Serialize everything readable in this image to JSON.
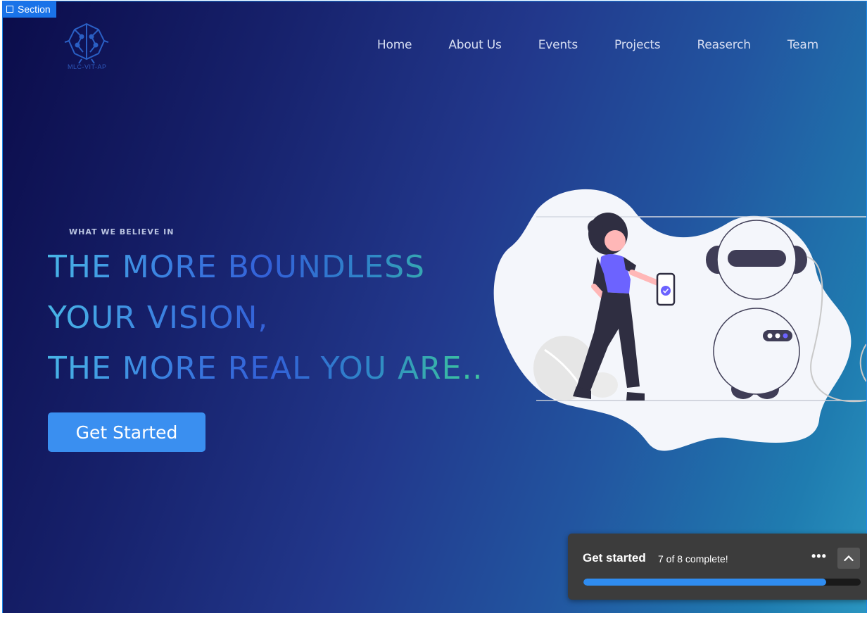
{
  "selection_tag": {
    "label": "Section"
  },
  "brand": {
    "logo_text": "MLC-VIT-AP"
  },
  "nav": {
    "items": [
      {
        "label": "Home"
      },
      {
        "label": "About Us"
      },
      {
        "label": "Events"
      },
      {
        "label": "Projects"
      },
      {
        "label": "Reaserch"
      },
      {
        "label": "Team"
      }
    ]
  },
  "hero": {
    "eyebrow": "WHAT WE BELIEVE IN",
    "headline_lines": [
      "THE MORE BOUNDLESS",
      "YOUR VISION,",
      "THE MORE REAL YOU ARE.."
    ],
    "cta_label": "Get Started"
  },
  "onboarding": {
    "title": "Get started",
    "progress_text": "7 of 8 complete!",
    "more_label": "•••",
    "completed": 7,
    "total": 8
  },
  "colors": {
    "accent": "#3a8ff0",
    "bg_dark": "#0b0c4a",
    "bg_light": "#2a95c0",
    "illustration_purple": "#6c63ff"
  }
}
